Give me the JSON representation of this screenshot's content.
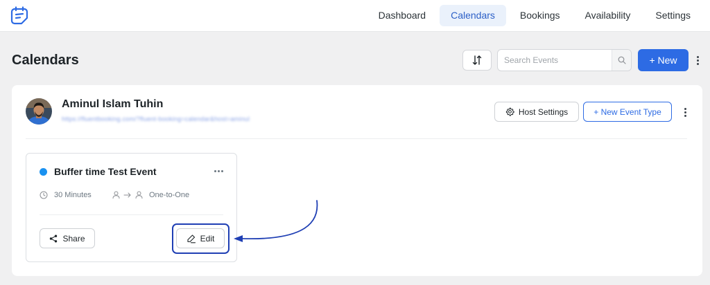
{
  "nav": {
    "items": [
      {
        "label": "Dashboard",
        "active": false
      },
      {
        "label": "Calendars",
        "active": true
      },
      {
        "label": "Bookings",
        "active": false
      },
      {
        "label": "Availability",
        "active": false
      },
      {
        "label": "Settings",
        "active": false
      }
    ]
  },
  "header": {
    "title": "Calendars",
    "search_placeholder": "Search Events",
    "new_label": "+ New"
  },
  "calendar": {
    "host_name": "Aminul Islam Tuhin",
    "host_url": "https://fluentbooking.com/?fluent-booking=calendar&host=aminul",
    "host_settings_label": "Host Settings",
    "new_event_type_label": "+ New Event Type"
  },
  "event": {
    "title": "Buffer time Test Event",
    "dot_color": "#1a91f0",
    "duration": "30 Minutes",
    "type": "One-to-One",
    "share_label": "Share",
    "edit_label": "Edit"
  },
  "colors": {
    "accent": "#2d6be4",
    "annotation": "#1f3fb4"
  },
  "icons": [
    "app-logo-icon",
    "sort-icon",
    "search-icon",
    "gear-icon",
    "clock-icon",
    "user-icon",
    "arrow-right-icon",
    "share-icon",
    "pencil-icon",
    "kebab-icon",
    "ellipsis-icon"
  ]
}
